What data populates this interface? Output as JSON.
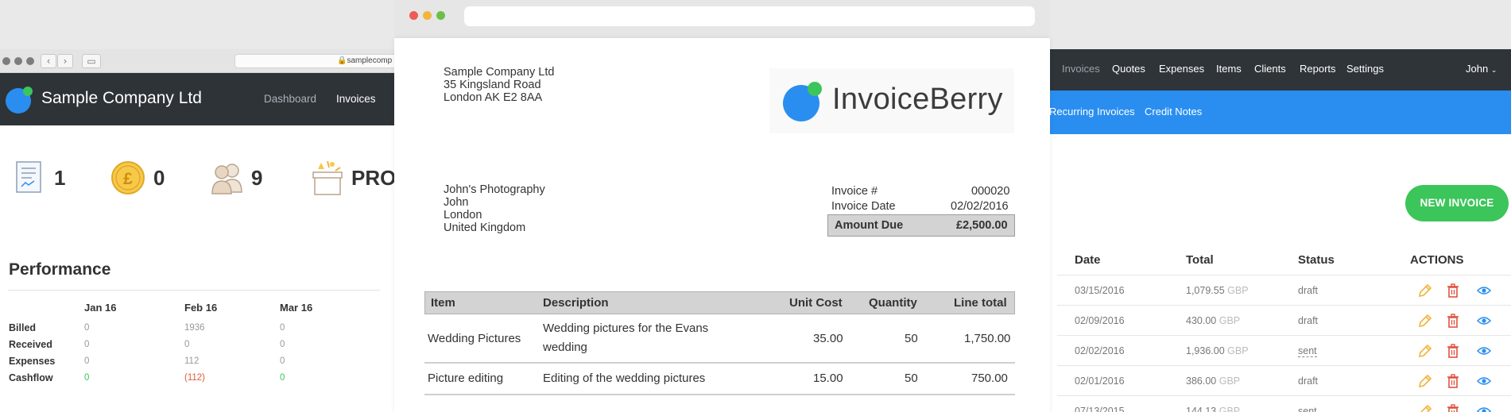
{
  "left_window": {
    "url": "samplecomp",
    "company_name": "Sample Company Ltd",
    "nav": [
      {
        "label": "Dashboard"
      },
      {
        "label": "Invoices"
      }
    ],
    "stats": [
      {
        "icon": "invoice-document-icon",
        "value": "1"
      },
      {
        "icon": "pound-coin-icon",
        "value": "0"
      },
      {
        "icon": "users-icon",
        "value": "9"
      },
      {
        "icon": "gift-box-icon",
        "value": "PRO"
      }
    ],
    "performance": {
      "title": "Performance",
      "columns": [
        "Jan 16",
        "Feb 16",
        "Mar 16"
      ],
      "rows": [
        {
          "label": "Billed",
          "values": [
            "0",
            "1936",
            "0"
          ]
        },
        {
          "label": "Received",
          "values": [
            "0",
            "0",
            "0"
          ]
        },
        {
          "label": "Expenses",
          "values": [
            "0",
            "112",
            "0"
          ]
        },
        {
          "label": "Cashflow",
          "values": [
            "0",
            "(112)",
            "0"
          ]
        }
      ]
    }
  },
  "invoice_document": {
    "from": {
      "line1": "Sample Company Ltd",
      "line2": "35 Kingsland Road",
      "line3": "London AK E2 8AA"
    },
    "logo_text": "InvoiceBerry",
    "to": {
      "line1": "John's Photography",
      "line2": "John",
      "line3": "London",
      "line4": "United Kingdom"
    },
    "invoice_number_label": "Invoice #",
    "invoice_number": "000020",
    "invoice_date_label": "Invoice Date",
    "invoice_date": "02/02/2016",
    "amount_due_label": "Amount Due",
    "amount_due": "£2,500.00",
    "table": {
      "headers": [
        "Item",
        "Description",
        "Unit Cost",
        "Quantity",
        "Line total"
      ],
      "rows": [
        {
          "item": "Wedding Pictures",
          "desc1": "Wedding pictures for the Evans",
          "desc2": "wedding",
          "unit_cost": "35.00",
          "quantity": "50",
          "line_total": "1,750.00"
        },
        {
          "item": "Picture editing",
          "desc1": "Editing of the wedding pictures",
          "unit_cost": "15.00",
          "quantity": "50",
          "line_total": "750.00"
        }
      ]
    }
  },
  "right_window": {
    "nav": [
      {
        "label": "Invoices"
      },
      {
        "label": "Quotes"
      },
      {
        "label": "Expenses"
      },
      {
        "label": "Items"
      },
      {
        "label": "Clients"
      },
      {
        "label": "Reports"
      },
      {
        "label": "Settings"
      }
    ],
    "user": "John",
    "subnav": [
      {
        "label": "Recurring Invoices"
      },
      {
        "label": "Credit Notes"
      }
    ],
    "new_invoice_label": "NEW INVOICE",
    "table_headers": [
      "Date",
      "Total",
      "Status",
      "ACTIONS"
    ],
    "rows": [
      {
        "date": "03/15/2016",
        "amount": "1,079.55",
        "currency": "GBP",
        "status": "draft"
      },
      {
        "date": "02/09/2016",
        "amount": "430.00",
        "currency": "GBP",
        "status": "draft"
      },
      {
        "date": "02/02/2016",
        "amount": "1,936.00",
        "currency": "GBP",
        "status": "sent"
      },
      {
        "date": "02/01/2016",
        "amount": "386.00",
        "currency": "GBP",
        "status": "draft"
      },
      {
        "date": "07/13/2015",
        "amount": "144.13",
        "currency": "GBP",
        "status": "sent"
      }
    ]
  },
  "colors": {
    "dark_header": "#2e3338",
    "blue_subnav": "#2a8ef0",
    "green_button": "#3cc55a",
    "cashflow_positive": "#3cc55a",
    "cashflow_negative": "#e05a3a",
    "edit_icon": "#f0b43a",
    "delete_icon": "#e0533f",
    "view_icon": "#2a8ef0"
  }
}
